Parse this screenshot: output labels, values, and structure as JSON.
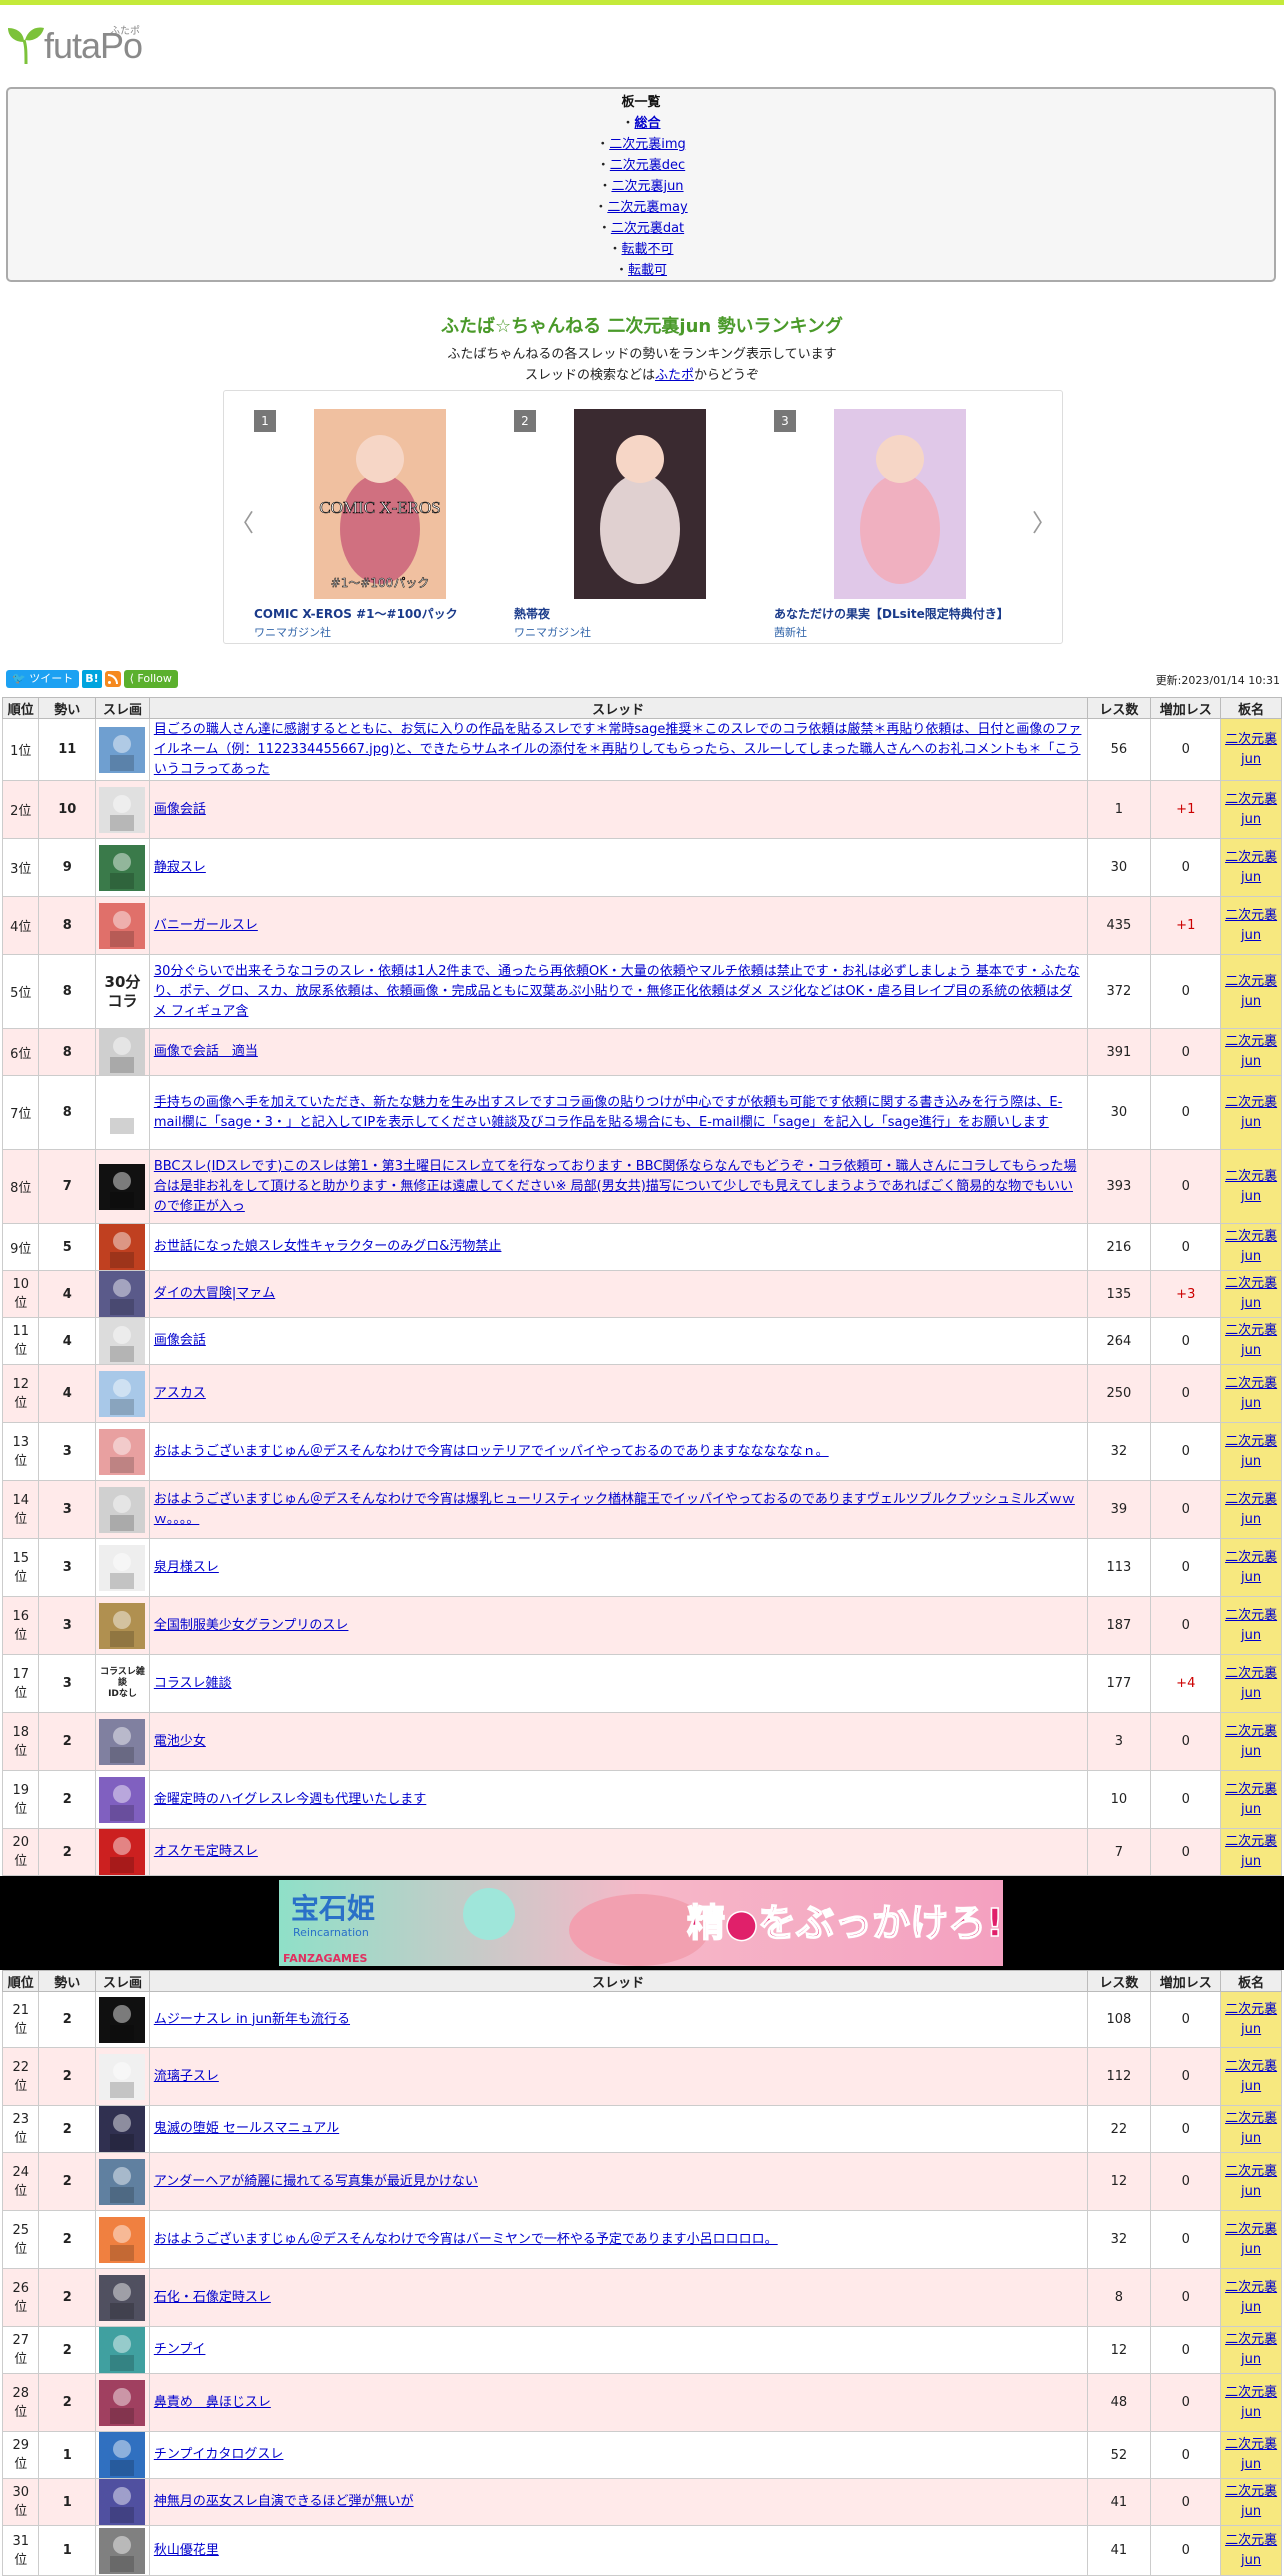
{
  "logo": {
    "text": "futaPo",
    "ruby": "ふたポ"
  },
  "boards": {
    "title": "板一覧",
    "items": [
      {
        "label": "総合",
        "bold": true
      },
      {
        "label": "二次元裏img"
      },
      {
        "label": "二次元裏dec"
      },
      {
        "label": "二次元裏jun"
      },
      {
        "label": "二次元裏may"
      },
      {
        "label": "二次元裏dat"
      },
      {
        "label": "転載不可"
      },
      {
        "label": "転載可"
      }
    ]
  },
  "heading": "ふたば☆ちゃんねる 二次元裏jun 勢いランキング",
  "desc": {
    "line1": "ふたばちゃんねるの各スレッドの勢いをランキング表示しています",
    "line2_pre": "スレッドの検索などは",
    "line2_link": "ふたポ",
    "line2_post": "からどうぞ"
  },
  "carousel": [
    {
      "rank": "1",
      "title": "COMIC X-EROS #1～#100パック",
      "publisher": "ワニマガジン社",
      "cover_text": "COMIC X-EROS",
      "cover_sub": "#1～#100パック"
    },
    {
      "rank": "2",
      "title": "熱帯夜",
      "publisher": "ワニマガジン社"
    },
    {
      "rank": "3",
      "title": "あなただけの果実【DLsite限定特典付き】",
      "publisher": "茜新社"
    }
  ],
  "social": {
    "tweet": "ツイート",
    "hatena": "B!",
    "follow": "Follow"
  },
  "updated": "更新:2023/01/14 10:31",
  "table_headers": [
    "順位",
    "勢い",
    "スレ画",
    "スレッド",
    "レス数",
    "増加レス",
    "板名"
  ],
  "board_name_line1": "二次元裏",
  "board_name_line2": "jun",
  "rows": [
    {
      "rank": "1位",
      "momentum": "11",
      "thread": "目ごろの職人さん達に感謝するとともに、お気に入りの作品を貼るスレです＊常時sage推奨＊このスレでのコラ依頼は厳禁＊再貼り依頼は、日付と画像のファイルネーム（例：1122334455667.jpg)と、できたらサムネイルの添付を＊再貼りしてもらったら、スルーしてしまった職人さんへのお礼コメントも＊「こういうコラってあった",
      "res": "56",
      "inc": "0",
      "thumb": "#6f9fd0"
    },
    {
      "rank": "2位",
      "momentum": "10",
      "thread": "画像会話",
      "res": "1",
      "inc": "+1",
      "thumb": "#e0e0e0"
    },
    {
      "rank": "3位",
      "momentum": "9",
      "thread": "静寂スレ",
      "res": "30",
      "inc": "0",
      "thumb": "#3a7a4a"
    },
    {
      "rank": "4位",
      "momentum": "8",
      "thread": "バニーガールスレ",
      "res": "435",
      "inc": "+1",
      "thumb": "#e0706a"
    },
    {
      "rank": "5位",
      "momentum": "8",
      "thread": "30分ぐらいで出来そうなコラのスレ・依頼は1人2件まで、通ったら再依頼OK・大量の依頼やマルチ依頼は禁止です・お礼は必ずしましょう 基本です・ふたなり、ポテ、グロ、スカ、放尿系依頼は、依頼画像・完成品ともに双葉あぷ小貼りで・無修正化依頼はダメ スジ化などはOK・虐ろ目レイプ目の系統の依頼はダメ フィギュア含",
      "res": "372",
      "inc": "0",
      "thumb_text": "30分\nコラ"
    },
    {
      "rank": "6位",
      "momentum": "8",
      "thread": "画像で会話　適当",
      "res": "391",
      "inc": "0",
      "thumb": "#cfcfcf"
    },
    {
      "rank": "7位",
      "momentum": "8",
      "thread": "手持ちの画像へ手を加えていただき、新たな魅力を生み出すスレですコラ画像の貼りつけが中心ですが依頼も可能です依頼に関する書き込みを行う際は、E-mail欄に「sage・3・」と記入してIPを表示してください雑談及びコラ作品を貼る場合にも、E-mail欄に「sage」を記入し「sage進行」をお願いします",
      "res": "30",
      "inc": "0",
      "thumb": "#ffffff"
    },
    {
      "rank": "8位",
      "momentum": "7",
      "thread": "BBCスレ(IDスレです)このスレは第1・第3土曜日にスレ立てを行なっております・BBC関係ならなんでもどうぞ・コラ依頼可・職人さんにコラしてもらった場合は是非お礼をして頂けると助かります・無修正は遠慮してください※ 局部(男女共)描写について少しでも見えてしまうようであればごく簡易的な物でもいいので修正が入っ",
      "res": "393",
      "inc": "0",
      "thumb": "#111111"
    },
    {
      "rank": "9位",
      "momentum": "5",
      "thread": "お世話になった娘スレ女性キャラクターのみグロ&汚物禁止",
      "res": "216",
      "inc": "0",
      "thumb": "#c04020"
    },
    {
      "rank": "10位",
      "momentum": "4",
      "thread": "ダイの大冒険|マァム",
      "res": "135",
      "inc": "+3",
      "thumb": "#5a5a8a"
    },
    {
      "rank": "11位",
      "momentum": "4",
      "thread": "画像会話",
      "res": "264",
      "inc": "0",
      "thumb": "#dcdcdc"
    },
    {
      "rank": "12位",
      "momentum": "4",
      "thread": "アスカス",
      "res": "250",
      "inc": "0",
      "thumb": "#a8c8e8"
    },
    {
      "rank": "13位",
      "momentum": "3",
      "thread": "おはようございますじゅん＠デスそんなわけで今宵はロッテリアでイッパイやっておるのでありますなななななｎ。",
      "res": "32",
      "inc": "0",
      "thumb": "#e8a0a0"
    },
    {
      "rank": "14位",
      "momentum": "3",
      "thread": "おはようございますじゅん＠デスそんなわけで今宵は爆乳ヒューリスティック楢林龍王でイッパイやっておるのでありますヴェルツブルクブッシュミルズｗｗｗ。。。。",
      "res": "39",
      "inc": "0",
      "thumb": "#d0d0d0"
    },
    {
      "rank": "15位",
      "momentum": "3",
      "thread": "泉月様スレ",
      "res": "113",
      "inc": "0",
      "thumb": "#eeeeee"
    },
    {
      "rank": "16位",
      "momentum": "3",
      "thread": "全国制服美少女グランプリのスレ",
      "res": "187",
      "inc": "0",
      "thumb": "#b09050"
    },
    {
      "rank": "17位",
      "momentum": "3",
      "thread": "コラスレ雑談",
      "res": "177",
      "inc": "+4",
      "thumb_text": "コラスレ雑談\nIDなし"
    },
    {
      "rank": "18位",
      "momentum": "2",
      "thread": "電池少女",
      "res": "3",
      "inc": "0",
      "thumb": "#8080a0"
    },
    {
      "rank": "19位",
      "momentum": "2",
      "thread": "金曜定時のハイグレスレ今週も代理いたします",
      "res": "10",
      "inc": "0",
      "thumb": "#8060c0"
    },
    {
      "rank": "20位",
      "momentum": "2",
      "thread": "オスケモ定時スレ",
      "res": "7",
      "inc": "0",
      "thumb": "#cc2020"
    },
    {
      "rank": "21位",
      "momentum": "2",
      "thread": "ムジーナスレ in jun新年も流行る",
      "res": "108",
      "inc": "0",
      "thumb": "#101010"
    },
    {
      "rank": "22位",
      "momentum": "2",
      "thread": "流璃子スレ",
      "res": "112",
      "inc": "0",
      "thumb": "#f0f0f0"
    },
    {
      "rank": "23位",
      "momentum": "2",
      "thread": "鬼滅の堕姫 セールスマニュアル",
      "res": "22",
      "inc": "0",
      "thumb": "#303050"
    },
    {
      "rank": "24位",
      "momentum": "2",
      "thread": "アンダーヘアが綺麗に撮れてる写真集が最近見かけない",
      "res": "12",
      "inc": "0",
      "thumb": "#6080a0"
    },
    {
      "rank": "25位",
      "momentum": "2",
      "thread": "おはようございますじゅん＠デスそんなわけで今宵はバーミヤンで一杯やる予定であります小呂ロロロロ。",
      "res": "32",
      "inc": "0",
      "thumb": "#f08040"
    },
    {
      "rank": "26位",
      "momentum": "2",
      "thread": "石化・石像定時スレ",
      "res": "8",
      "inc": "0",
      "thumb": "#505060"
    },
    {
      "rank": "27位",
      "momentum": "2",
      "thread": "チンプイ",
      "res": "12",
      "inc": "0",
      "thumb": "#40a0a0"
    },
    {
      "rank": "28位",
      "momentum": "2",
      "thread": "鼻責め　鼻ほじスレ",
      "res": "48",
      "inc": "0",
      "thumb": "#a04060"
    },
    {
      "rank": "29位",
      "momentum": "1",
      "thread": "チンプイカタログスレ",
      "res": "52",
      "inc": "0",
      "thumb": "#3070c0"
    },
    {
      "rank": "30位",
      "momentum": "1",
      "thread": "神無月の巫女スレ自演できるほど弾が無いが",
      "res": "41",
      "inc": "0",
      "thumb": "#5050a0"
    },
    {
      "rank": "31位",
      "momentum": "1",
      "thread": "秋山優花里",
      "res": "41",
      "inc": "0",
      "thumb": "#808080"
    }
  ],
  "ad": {
    "text_left": "宝石姫",
    "text_left_sub": "Reincarnation",
    "brand": "FANZAGAMES",
    "text_right": "精●をぶっかけろ!!"
  }
}
